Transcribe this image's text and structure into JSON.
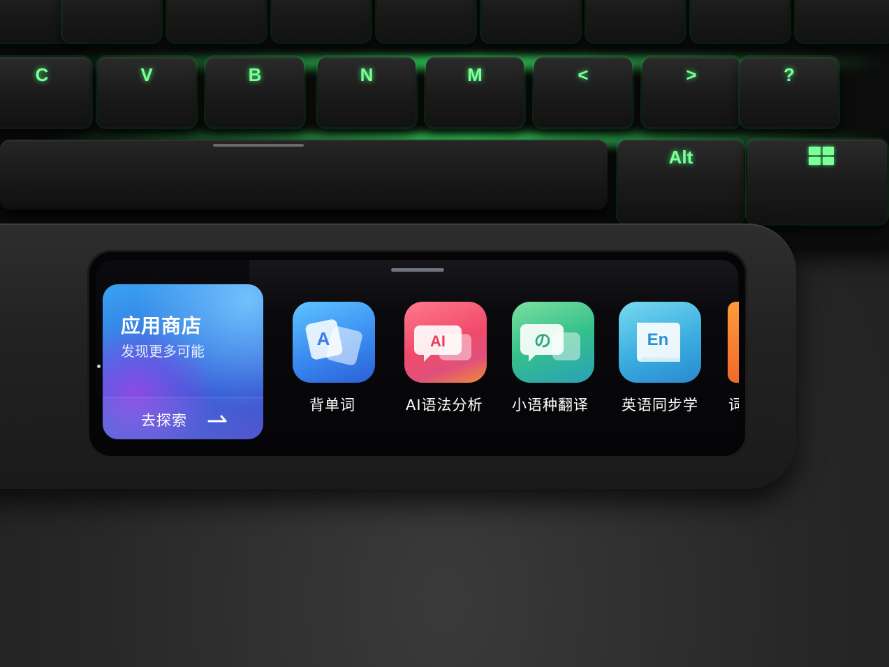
{
  "keyboard": {
    "row1_keys": [
      "",
      "",
      "",
      "",
      "",
      "",
      "",
      "",
      ""
    ],
    "row2_keys": [
      "C",
      "V",
      "B",
      "N",
      "M",
      "<",
      ">",
      "?"
    ],
    "alt_key": "Alt"
  },
  "device": {
    "app_store": {
      "title": "应用商店",
      "subtitle": "发现更多可能",
      "explore_label": "去探索"
    },
    "apps": [
      {
        "label": "背单词",
        "icon_glyph": "A",
        "icon": "flashcard-icon"
      },
      {
        "label": "AI语法分析",
        "icon_glyph": "AI",
        "icon": "ai-chat-icon"
      },
      {
        "label": "小语种翻译",
        "icon_glyph": "の",
        "icon": "translate-bubble-icon"
      },
      {
        "label": "英语同步学",
        "icon_glyph": "En",
        "icon": "book-icon"
      }
    ],
    "partial_app": {
      "label": "词"
    }
  },
  "colors": {
    "key_glow": "#3cff6e",
    "store_card": "#2f6fe0",
    "words_icon": "#3a8cf0",
    "ai_icon": "#f04a6a",
    "lang_icon": "#35c08a",
    "en_icon": "#3aaee0"
  }
}
